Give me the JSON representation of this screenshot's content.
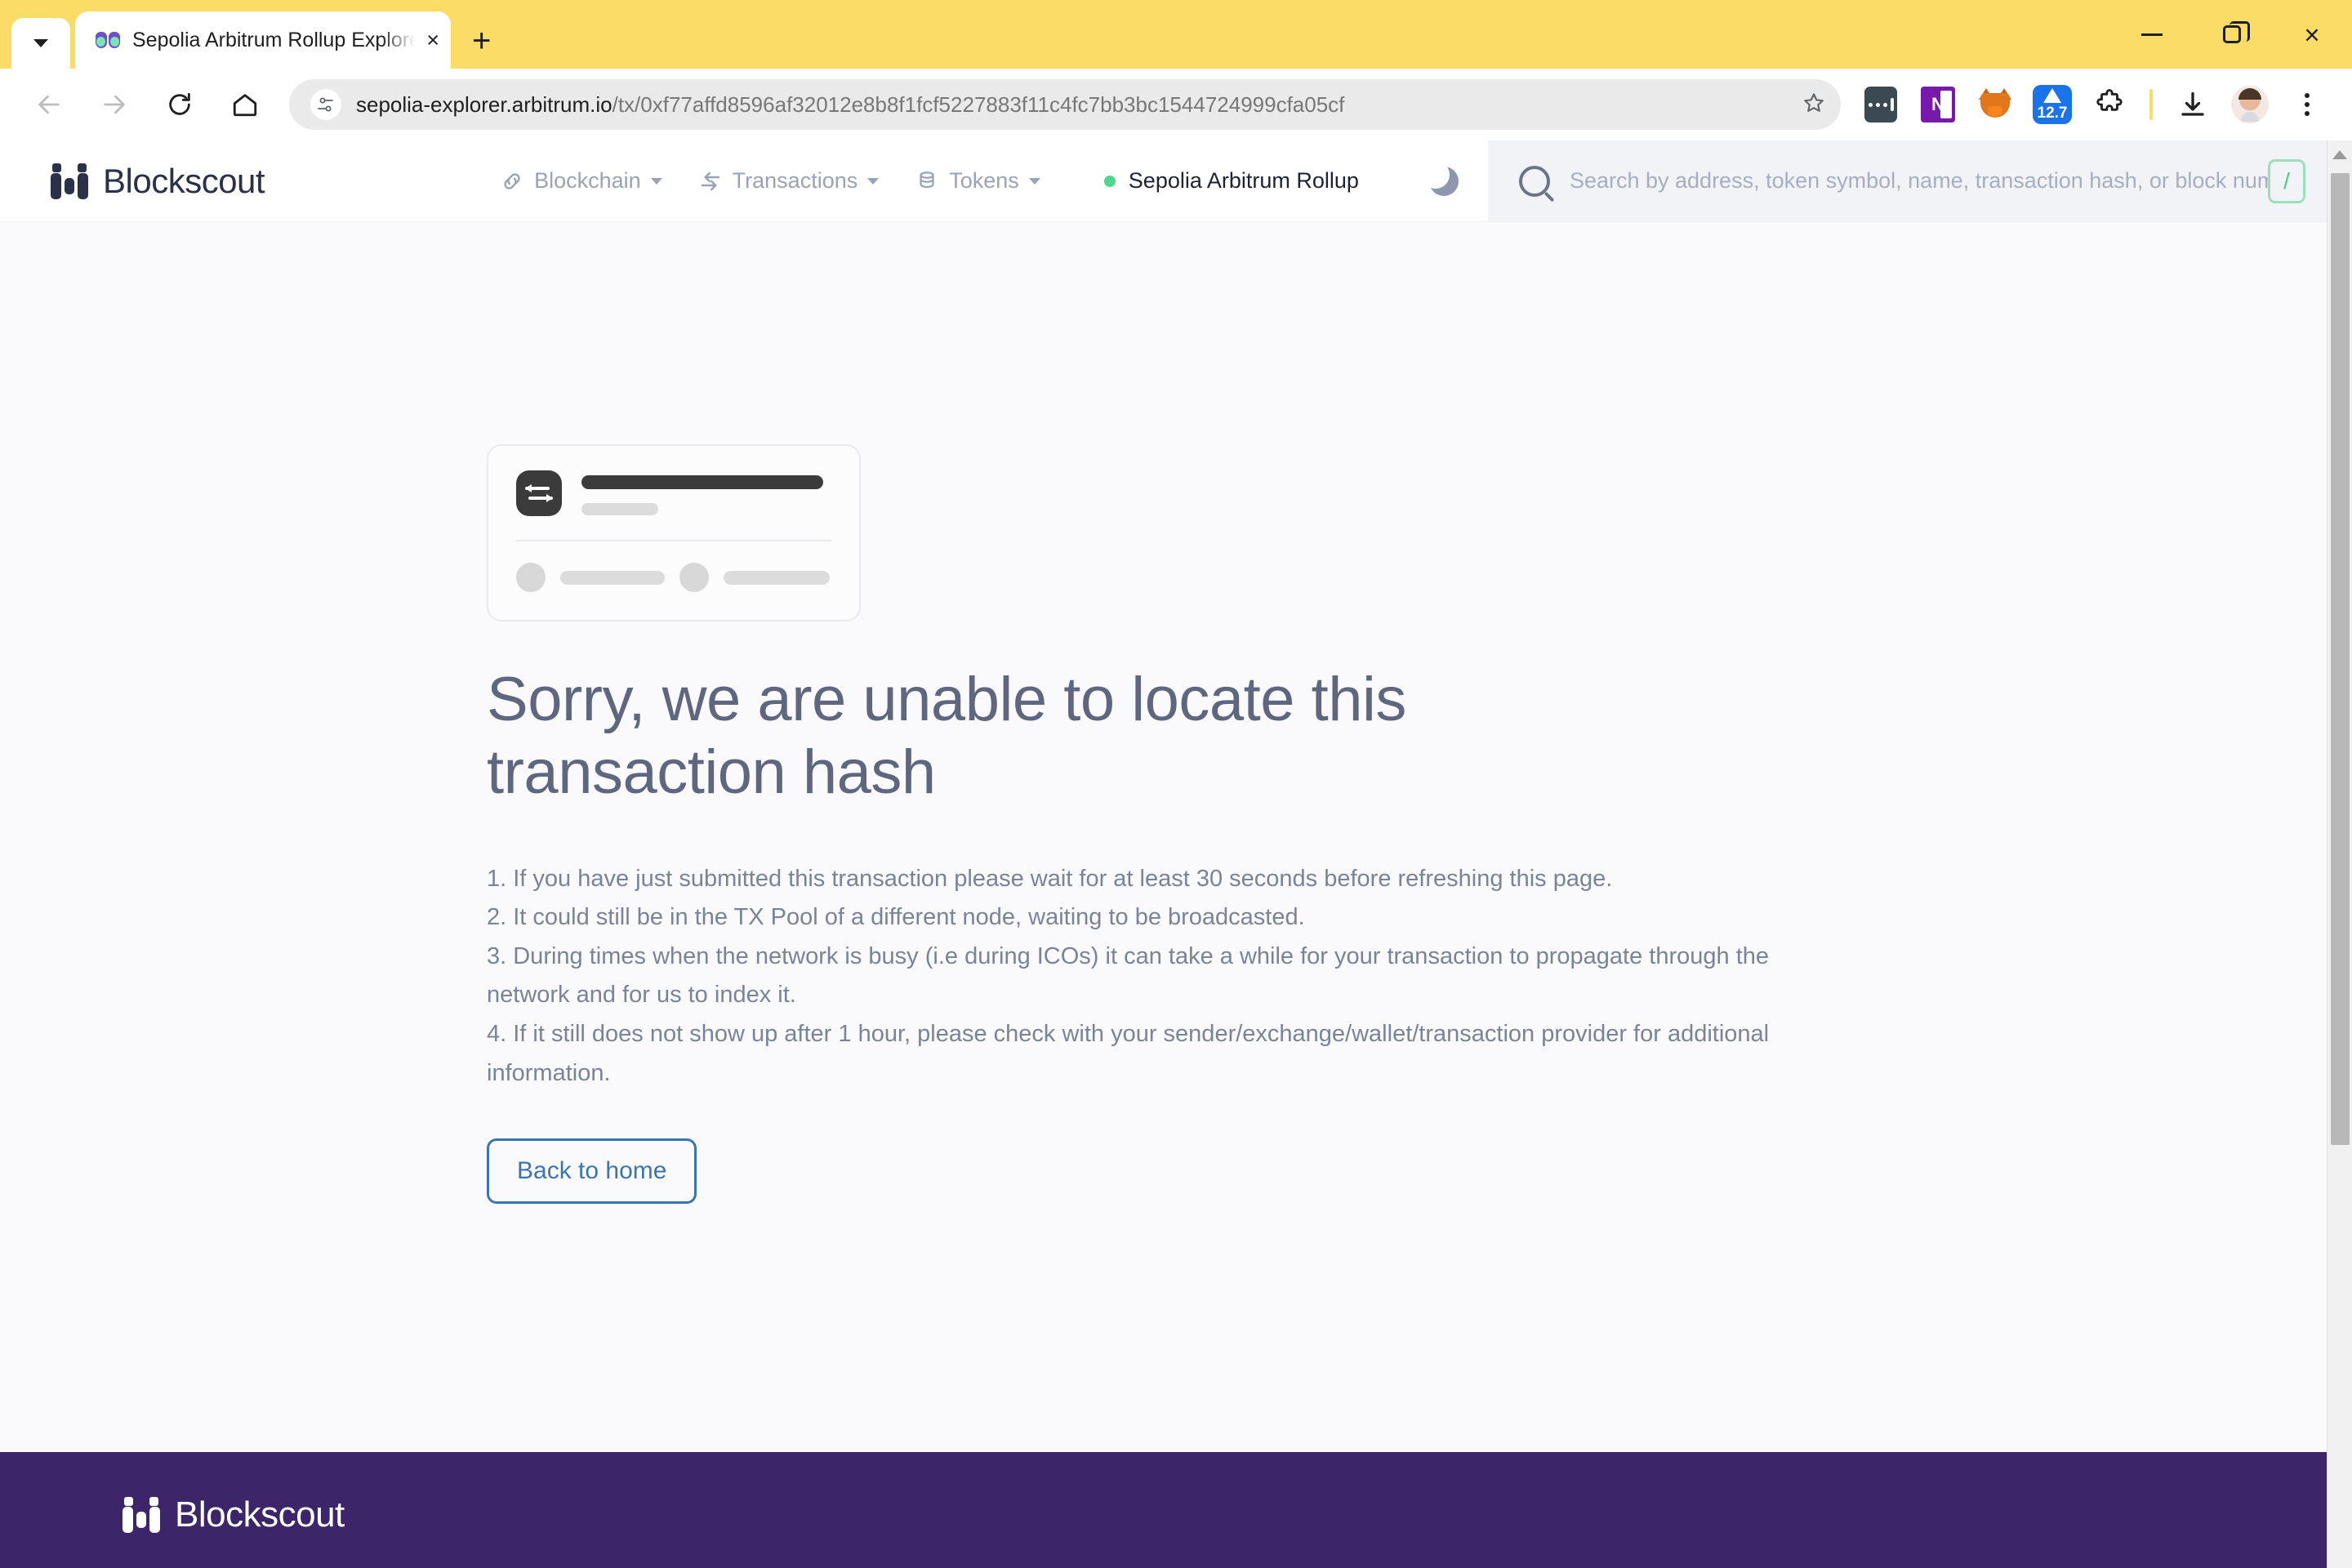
{
  "browser": {
    "tab": {
      "title": "Sepolia Arbitrum Rollup Explorer",
      "favicon_icon": "binoculars-icon",
      "close_label": "×"
    },
    "new_tab_label": "+",
    "tab_list_icon": "chevron-down-icon",
    "window_controls": {
      "minimize_icon": "minimize-icon",
      "maximize_icon": "restore-window-icon",
      "close_icon": "close-window-icon",
      "close_label": "×"
    },
    "toolbar": {
      "back_icon": "back-arrow-icon",
      "forward_icon": "forward-arrow-icon",
      "reload_icon": "reload-icon",
      "home_icon": "home-icon",
      "site_info_icon": "site-settings-icon",
      "bookmark_icon": "bookmark-star-icon",
      "url_domain": "sepolia-explorer.arbitrum.io",
      "url_path": "/tx/0xf77affd8596af32012e8b8f1fcf5227883f11c4fc7bb3bc1544724999cfa05cf",
      "extensions": [
        {
          "name": "dots-extension-icon"
        },
        {
          "name": "onenote-extension-icon",
          "label": "N"
        },
        {
          "name": "metamask-extension-icon"
        },
        {
          "name": "badge-extension-icon",
          "label": "12.7"
        },
        {
          "name": "extensions-puzzle-icon"
        }
      ],
      "download_icon": "download-icon",
      "profile_icon": "profile-avatar-icon",
      "menu_icon": "three-dot-menu-icon"
    }
  },
  "header": {
    "brand": "Blockscout",
    "logo_icon": "blockscout-logo-icon",
    "nav": [
      {
        "label": "Blockchain",
        "icon": "chain-link-icon",
        "has_caret": true
      },
      {
        "label": "Transactions",
        "icon": "transactions-arrow-icon",
        "has_caret": true
      },
      {
        "label": "Tokens",
        "icon": "coins-stack-icon",
        "has_caret": true
      }
    ],
    "network": {
      "label": "Sepolia Arbitrum Rollup",
      "status_color": "#4ED88F"
    },
    "theme_toggle_icon": "moon-icon",
    "search": {
      "icon": "search-icon",
      "placeholder": "Search by address, token symbol, name, transaction hash, or block number",
      "value": "",
      "shortcut_key": "/"
    }
  },
  "main": {
    "illustration": {
      "icon": "transaction-swap-icon",
      "description": "transaction card placeholder skeleton"
    },
    "title": "Sorry, we are unable to locate this transaction hash",
    "reasons": [
      "1. If you have just submitted this transaction please wait for at least 30 seconds before refreshing this page.",
      "2. It could still be in the TX Pool of a different node, waiting to be broadcasted.",
      "3. During times when the network is busy (i.e during ICOs) it can take a while for your transaction to propagate through the network and for us to index it.",
      "4. If it still does not show up after 1 hour, please check with your sender/exchange/wallet/transaction provider for additional information."
    ],
    "back_button_label": "Back to home"
  },
  "footer": {
    "brand": "Blockscout",
    "logo_icon": "blockscout-logo-icon",
    "background_color": "#3C2569"
  },
  "scrollbar": {
    "up_arrow_icon": "scroll-up-arrow-icon"
  },
  "colors": {
    "tab_strip": "#FBDC67",
    "page_background": "#FAFAFC",
    "accent_link": "#3A75B0",
    "footer_purple": "#3C2569",
    "status_green": "#4ED88F"
  }
}
